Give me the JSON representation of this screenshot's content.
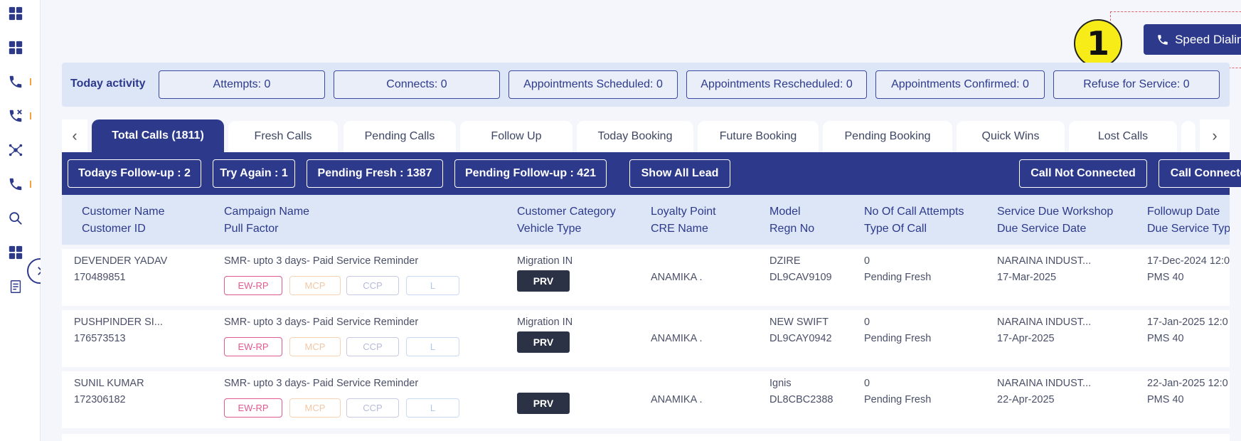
{
  "callout_number": "1",
  "speed_dialing": {
    "label": "Speed Dialing",
    "icon": "phone-icon"
  },
  "today_activity": {
    "label": "Today activity",
    "items": [
      "Attempts: 0",
      "Connects: 0",
      "Appointments Scheduled: 0",
      "Appointments Rescheduled: 0",
      "Appointments Confirmed: 0",
      "Refuse for Service: 0"
    ]
  },
  "tabs": {
    "prev": "‹",
    "next": "›",
    "items": [
      "Total Calls (1811)",
      "Fresh Calls",
      "Pending Calls",
      "Follow Up",
      "Today Booking",
      "Future Booking",
      "Pending Booking",
      "Quick Wins",
      "Lost Calls"
    ],
    "active": "Total Calls (1811)"
  },
  "filters": {
    "todays_followup": "Todays Follow-up : 2",
    "try_again": "Try Again : 1",
    "pending_fresh": "Pending Fresh : 1387",
    "pending_followup": "Pending Follow-up : 421",
    "show_all": "Show All Lead",
    "call_not_connected": "Call Not Connected",
    "call_connected": "Call Connected"
  },
  "columns": [
    {
      "line1": "Customer Name",
      "line2": "Customer ID"
    },
    {
      "line1": "Campaign Name",
      "line2": "Pull Factor"
    },
    {
      "line1": "Customer Category",
      "line2": "Vehicle Type"
    },
    {
      "line1": "Loyalty Point",
      "line2": "CRE Name"
    },
    {
      "line1": "Model",
      "line2": "Regn No"
    },
    {
      "line1": "No Of Call Attempts",
      "line2": "Type Of Call"
    },
    {
      "line1": "Service Due Workshop",
      "line2": "Due Service Date"
    },
    {
      "line1": "Followup Date",
      "line2": "Due Service Typ"
    }
  ],
  "tags": {
    "ew": "EW-RP",
    "mcp": "MCP",
    "ccp": "CCP",
    "l": "L",
    "vehicle": "PRV"
  },
  "rows": [
    {
      "name": "DEVENDER YADAV",
      "id": "170489851",
      "campaign": "SMR- upto 3 days- Paid Service Reminder",
      "category": "Migration IN",
      "cre": "ANAMIKA .",
      "model": "DZIRE",
      "regn": "DL9CAV9109",
      "attempts": "0",
      "call_type": "Pending Fresh",
      "workshop": "NARAINA INDUST...",
      "due_date": "17-Mar-2025",
      "followup": "17-Dec-2024 12:0",
      "service_type": "PMS 40"
    },
    {
      "name": "PUSHPINDER SI...",
      "id": "176573513",
      "campaign": "SMR- upto 3 days- Paid Service Reminder",
      "category": "Migration IN",
      "cre": "ANAMIKA .",
      "model": "NEW SWIFT",
      "regn": "DL9CAY0942",
      "attempts": "0",
      "call_type": "Pending Fresh",
      "workshop": "NARAINA INDUST...",
      "due_date": "17-Apr-2025",
      "followup": "17-Jan-2025 12:0",
      "service_type": "PMS 40"
    },
    {
      "name": "SUNIL KUMAR",
      "id": "172306182",
      "campaign": "SMR- upto 3 days- Paid Service Reminder",
      "category": "",
      "cre": "ANAMIKA .",
      "model": "Ignis",
      "regn": "DL8CBC2388",
      "attempts": "0",
      "call_type": "Pending Fresh",
      "workshop": "NARAINA INDUST...",
      "due_date": "22-Apr-2025",
      "followup": "22-Jan-2025 12:0",
      "service_type": "PMS 40"
    }
  ],
  "sidebar_icons": [
    "dashboard-icon",
    "dashboard-icon",
    "phone-icon",
    "phone-missed-icon",
    "network-icon",
    "phone-icon",
    "search-icon",
    "dashboard-icon",
    "report-icon"
  ],
  "colors": {
    "primary": "#2d3a8c",
    "callout": "#f7ec17",
    "ew_tag": "#e05a8f"
  }
}
